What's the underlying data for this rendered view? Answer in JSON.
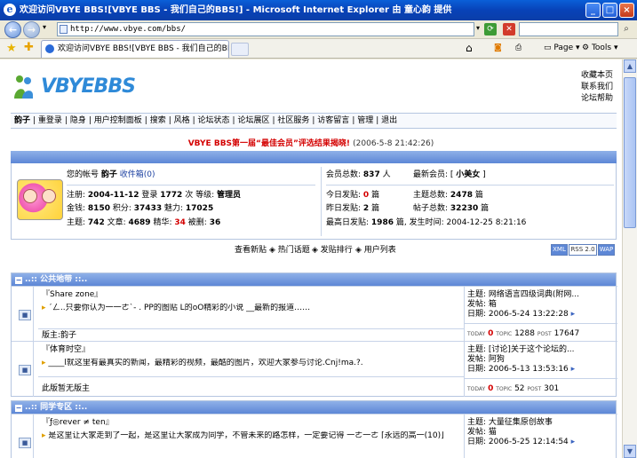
{
  "window": {
    "title": "欢迎访问VBYE BBS![VBYE BBS - 我们自己的BBS!] - Microsoft Internet Explorer 由 童心韵 提供",
    "url": "http://www.vbye.com/bbs/",
    "tab_title": "欢迎访问VBYE BBS![VBYE BBS - 我们自己的BBS!]",
    "toolbar": {
      "page": "Page",
      "tools": "Tools"
    }
  },
  "site": {
    "logo_text": "VBYEBBS",
    "top_links": [
      "收藏本页",
      "联系我们",
      "论坛帮助"
    ],
    "menu": [
      "韵子",
      "重登录",
      "隐身",
      "用户控制面板",
      "搜索",
      "风格",
      "论坛状态",
      "论坛展区",
      "社区服务",
      "访客留言",
      "管理",
      "退出"
    ],
    "announce": "VBYE BBS第一届“最佳会员”评选结果揭晓!",
    "announce_time": "(2006-5-8 21:42:26)"
  },
  "user": {
    "account_label": "您的帐号",
    "account_name": "韵子",
    "inbox_label": "收件箱(0)",
    "reg_label": "注册:",
    "reg_date": "2004-11-12",
    "login_label": "登录",
    "logins": "1772",
    "login_unit": "次",
    "level_label": "等级:",
    "level": "管理员",
    "gold_label": "金钱:",
    "gold": "8150",
    "points_label": "积分:",
    "points": "37433",
    "charm_label": "魅力:",
    "charm": "17025",
    "topics_label": "主题:",
    "topics": "742",
    "articles_label": "文章:",
    "articles": "4689",
    "elite_label": "精华:",
    "elite": "34",
    "deleted_label": "被删:",
    "deleted": "36"
  },
  "stats": {
    "members_label": "会员总数:",
    "members": "837",
    "members_unit": "人",
    "newest_label": "最新会员:",
    "newest": "小美女",
    "today_label": "今日发贴:",
    "today": "0",
    "today_unit": "篇",
    "topics_label": "主题总数:",
    "topics": "2478",
    "topics_unit": "篇",
    "yesterday_label": "昨日发贴:",
    "yesterday": "2",
    "yesterday_unit": "篇",
    "posts_label": "帖子总数:",
    "posts": "32230",
    "posts_unit": "篇",
    "max_label": "最高日发贴:",
    "max": "1986",
    "max_unit": "篇,",
    "max_time_label": "发生时间:",
    "max_time": "2004-12-25 8:21:16"
  },
  "actions": [
    "查看新贴",
    "热门话题",
    "发贴排行",
    "用户列表"
  ],
  "badges": [
    "XML",
    "RSS 2.0",
    "WAP"
  ],
  "sections": [
    {
      "title": "..:: 公共地带 ::..",
      "forums": [
        {
          "name": "『Share zone』",
          "desc": "´ㄥ..只要你认为一一ㄜ`- . PP的图贴 L的oO精彩的小说 __最新的报道……",
          "moderator_label": "版主:",
          "moderator": "韵子",
          "last_topic_label": "主题:",
          "last_topic": "网络语言四级词典(附网...",
          "last_author_label": "发帖:",
          "last_author": "箱",
          "last_date_label": "日期:",
          "last_date": "2006-5-24 13:22:28",
          "today_label": "TODAY",
          "today": "0",
          "topic_label": "TOPIC",
          "topic": "1288",
          "post_label": "POST",
          "post": "17647"
        },
        {
          "name": "『体育时空』",
          "desc": "____l就这里有最真实的新闻，最精彩的视频，最酷的图片，欢迎大家参与讨论.Cnj!ma.?.",
          "moderator_label": "",
          "moderator": "此版暂无版主",
          "last_topic_label": "主题:",
          "last_topic": "[讨论]关于这个论坛的...",
          "last_author_label": "发帖:",
          "last_author": "阿狗",
          "last_date_label": "日期:",
          "last_date": "2006-5-13 13:53:16",
          "today_label": "TODAY",
          "today": "0",
          "topic_label": "TOPIC",
          "topic": "52",
          "post_label": "POST",
          "post": "301"
        }
      ]
    },
    {
      "title": "..:: 同学专区 ::..",
      "forums": [
        {
          "name": "『ƒ◎rever ≠ ten』",
          "desc": "是这里让大家走到了一起，是这里让大家成为同学，不管未来的路怎样，一定要记得 一ㄜ一ㄜ ⌈永远的高一(10)⌋",
          "last_topic_label": "主题:",
          "last_topic": "大量征集原创故事",
          "last_author_label": "发帖:",
          "last_author": "猫",
          "last_date_label": "日期:",
          "last_date": "2006-5-25 12:14:54"
        }
      ]
    }
  ]
}
